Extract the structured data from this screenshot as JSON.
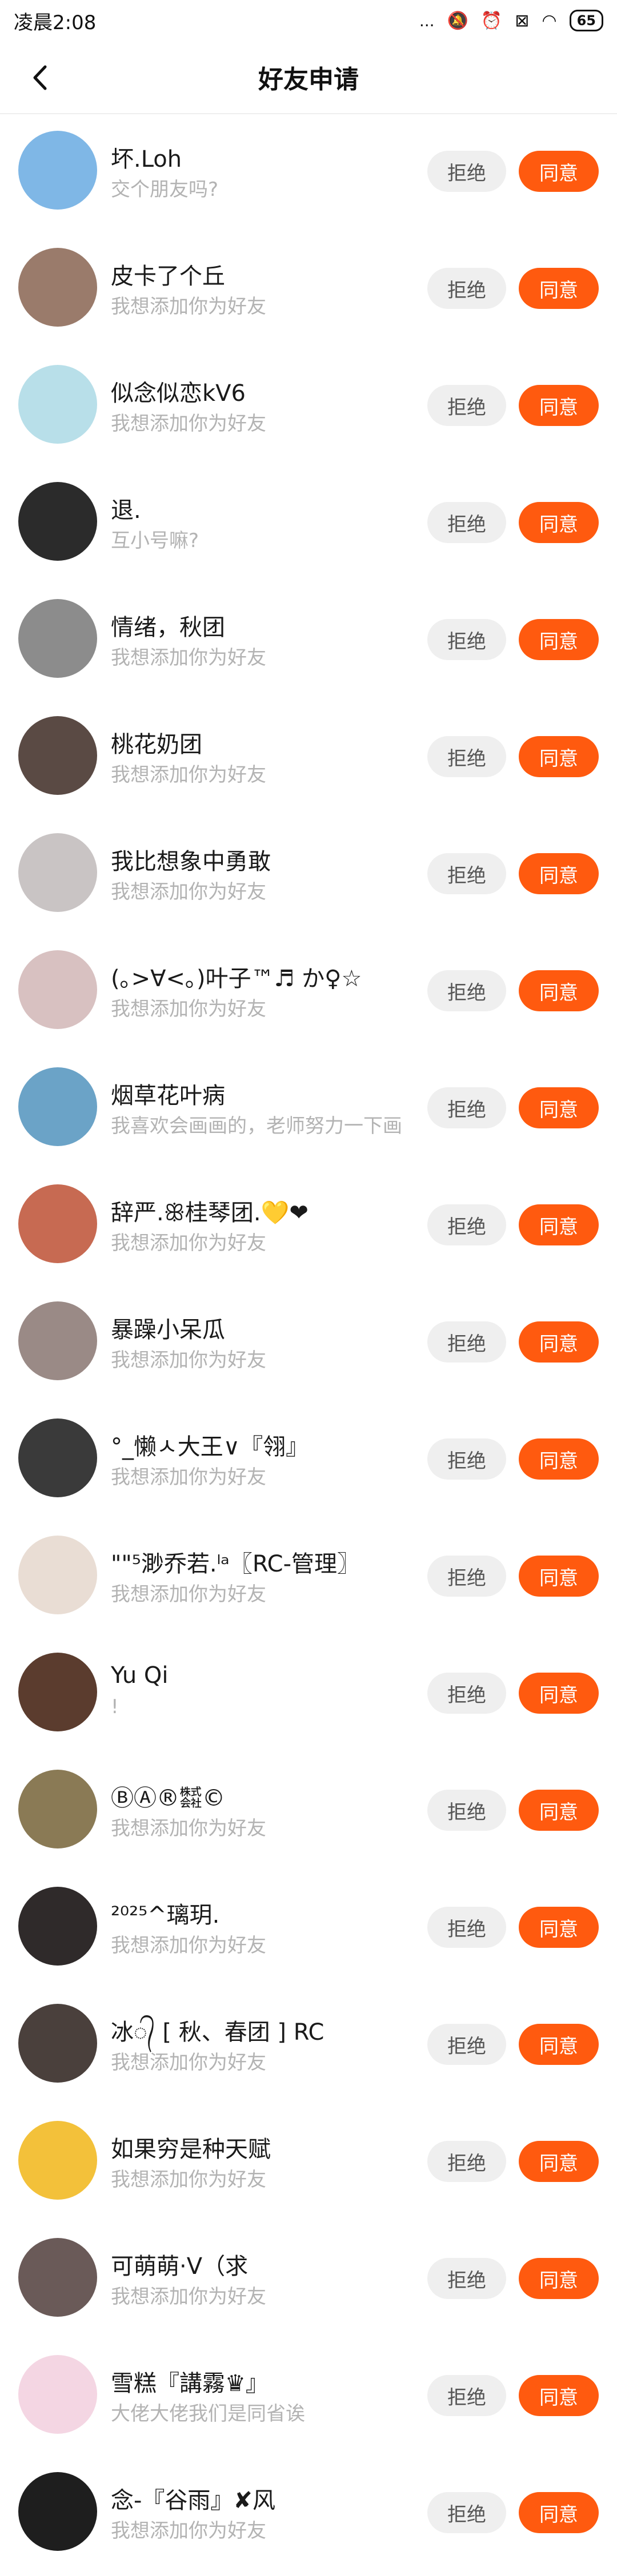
{
  "status_bar": {
    "time": "凌晨2:08",
    "dots": "...",
    "battery": "65"
  },
  "header": {
    "title": "好友申请"
  },
  "buttons": {
    "reject": "拒绝",
    "accept": "同意"
  },
  "requests": [
    {
      "name": "坏.Loh",
      "message": "交个朋友吗?",
      "avatar_color": "#7fb7e6"
    },
    {
      "name": "皮卡了个丘",
      "message": "我想添加你为好友",
      "avatar_color": "#9a7b6b"
    },
    {
      "name": "似念似恋kV6",
      "message": "我想添加你为好友",
      "avatar_color": "#b8dfe9"
    },
    {
      "name": "退.",
      "message": "互小号嘛?",
      "avatar_color": "#2b2b2b"
    },
    {
      "name": "情绪，秋团",
      "message": "我想添加你为好友",
      "avatar_color": "#8c8c8c"
    },
    {
      "name": "桃花奶团",
      "message": "我想添加你为好友",
      "avatar_color": "#5a4a44"
    },
    {
      "name": "我比想象中勇敢",
      "message": "我想添加你为好友",
      "avatar_color": "#c9c4c4"
    },
    {
      "name": "(｡>∀<｡)叶子™♬ か♀☆",
      "message": "我想添加你为好友",
      "avatar_color": "#d8c1c1"
    },
    {
      "name": "烟草花叶病",
      "message": "我喜欢会画画的，老师努力一下画",
      "avatar_color": "#6ba3c7"
    },
    {
      "name": "辞严.ꕥ桂琴团.💛❤",
      "message": "我想添加你为好友",
      "avatar_color": "#c76a52"
    },
    {
      "name": "暴躁小呆瓜",
      "message": "我想添加你为好友",
      "avatar_color": "#9a8a86"
    },
    {
      "name": "°_懒ㅅ大王∨『翎』",
      "message": "我想添加你为好友",
      "avatar_color": "#3a3a3a"
    },
    {
      "name": "\"\"⁵渺乔若.ˡᵃ〖RC-管理〗",
      "message": "我想添加你为好友",
      "avatar_color": "#e9ddd4"
    },
    {
      "name": "Yu Qi",
      "message": "!",
      "avatar_color": "#5b3c2e"
    },
    {
      "name": "ⒷⒶ®㍿©",
      "message": "我想添加你为好友",
      "avatar_color": "#8a7a55"
    },
    {
      "name": "²⁰²⁵^璃玥.",
      "message": "我想添加你为好友",
      "avatar_color": "#2f2a2a"
    },
    {
      "name": "冰᭄ [ 秋、春团 ] RC",
      "message": "我想添加你为好友",
      "avatar_color": "#4a403c"
    },
    {
      "name": "如果穷是种天赋",
      "message": "我想添加你为好友",
      "avatar_color": "#f3c13a"
    },
    {
      "name": "可萌萌·V（求",
      "message": "我想添加你为好友",
      "avatar_color": "#6a5a58"
    },
    {
      "name": "雪糕『講霧♛』",
      "message": "大佬大佬我们是同省诶",
      "avatar_color": "#f4d6e3"
    },
    {
      "name": "念-『谷雨』✘风",
      "message": "我想添加你为好友",
      "avatar_color": "#1e1e1e"
    }
  ]
}
